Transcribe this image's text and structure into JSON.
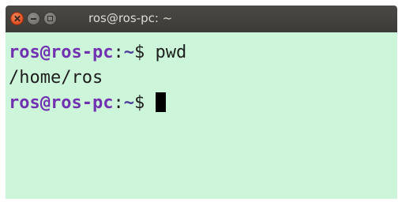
{
  "window": {
    "title": "ros@ros-pc: ~"
  },
  "terminal": {
    "lines": [
      {
        "prompt_user": "ros@ros-pc",
        "prompt_sep": ":",
        "prompt_path": "~",
        "prompt_symbol": "$ ",
        "command": "pwd"
      },
      {
        "output": "/home/ros"
      },
      {
        "prompt_user": "ros@ros-pc",
        "prompt_sep": ":",
        "prompt_path": "~",
        "prompt_symbol": "$ ",
        "command": ""
      }
    ]
  },
  "colors": {
    "background": "#cdf5d9",
    "titlebar": "#3c3b37",
    "prompt_user": "#7131b0",
    "close_button": "#e4562a"
  },
  "icons": {
    "close": "close-icon",
    "minimize": "minimize-icon",
    "maximize": "maximize-icon"
  }
}
